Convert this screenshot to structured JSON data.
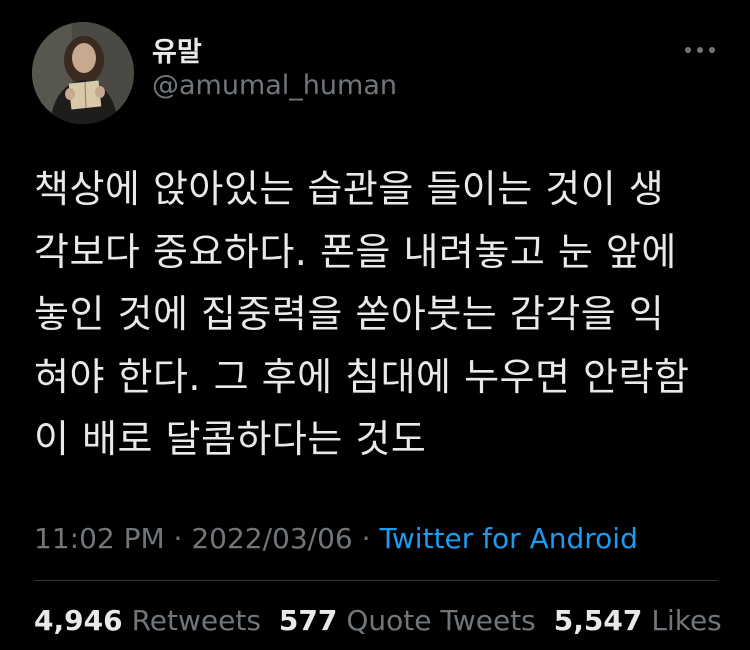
{
  "author": {
    "display_name": "유말",
    "handle": "@amumal_human",
    "avatar_icon": "profile-photo-avatar"
  },
  "tweet": {
    "text": "책상에 앉아있는 습관을 들이는 것이 생\n각보다 중요하다. 폰을 내려놓고 눈 앞에\n놓인 것에 집중력을 쏟아붓는 감각을 익\n혀야 한다. 그 후에 침대에 누우면 안락함\n이 배로 달콤하다는 것도"
  },
  "meta": {
    "time": "11:02 PM",
    "separator1": " · ",
    "date": "2022/03/06",
    "separator2": " · ",
    "source": "Twitter for Android"
  },
  "stats": {
    "retweets_count": "4,946",
    "retweets_label": "Retweets",
    "quotes_count": "577",
    "quotes_label": "Quote Tweets",
    "likes_count": "5,547",
    "likes_label": "Likes"
  },
  "icons": {
    "more": "more-horizontal-icon"
  },
  "colors": {
    "background": "#000000",
    "text": "#e7e9ea",
    "secondary": "#71767b",
    "link": "#1d9bf0",
    "divider": "#2f3336"
  }
}
